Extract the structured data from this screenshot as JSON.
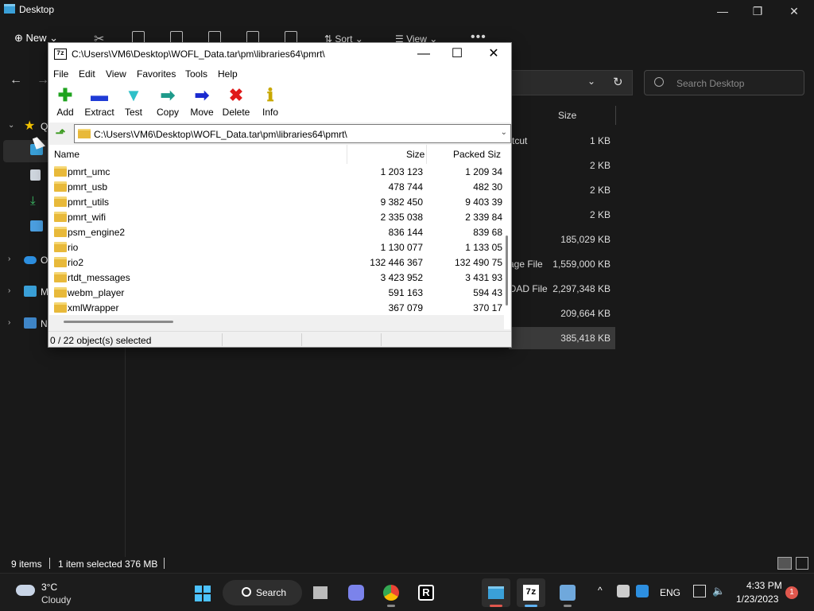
{
  "explorer": {
    "title": "Desktop",
    "toolbar": {
      "new_label": "New",
      "sort_label": "Sort",
      "view_label": "View",
      "more": "•••"
    },
    "search_placeholder": "Search Desktop",
    "sidebar": [
      {
        "label": "Q",
        "icon": "star-icon",
        "expand": "⌄"
      },
      {
        "label": "",
        "icon": "desktop-folder-icon",
        "expand": ""
      },
      {
        "label": "",
        "icon": "documents-icon",
        "expand": ""
      },
      {
        "label": "",
        "icon": "downloads-icon",
        "expand": ""
      },
      {
        "label": "",
        "icon": "pictures-icon",
        "expand": ""
      },
      {
        "label": "O",
        "icon": "onedrive-icon",
        "expand": "›"
      },
      {
        "label": "M",
        "icon": "this-pc-icon",
        "expand": "›"
      },
      {
        "label": "N",
        "icon": "network-icon",
        "expand": "›"
      }
    ],
    "size_column": "Size",
    "rows": [
      {
        "type": "rtcut",
        "size": "1 KB"
      },
      {
        "type": "",
        "size": "2 KB"
      },
      {
        "type": "",
        "size": "2 KB"
      },
      {
        "type": "",
        "size": "2 KB"
      },
      {
        "type": "",
        "size": "185,029 KB"
      },
      {
        "type": "age File",
        "size": "1,559,000 KB"
      },
      {
        "type": "OAD File",
        "size": "2,297,348 KB"
      },
      {
        "type": "",
        "size": "209,664 KB"
      },
      {
        "type": "",
        "size": "385,418 KB"
      }
    ],
    "status": {
      "items": "9 items",
      "selected": "1 item selected  376 MB"
    }
  },
  "sevenzip": {
    "icon_text": "7z",
    "title": "C:\\Users\\VM6\\Desktop\\WOFL_Data.tar\\pm\\libraries64\\pmrt\\",
    "menu": [
      "File",
      "Edit",
      "View",
      "Favorites",
      "Tools",
      "Help"
    ],
    "tools": [
      {
        "label": "Add",
        "glyph": "✚",
        "color": "#1fa31f"
      },
      {
        "label": "Extract",
        "glyph": "▬",
        "color": "#1f3bd6"
      },
      {
        "label": "Test",
        "glyph": "▼",
        "color": "#2ec0c8"
      },
      {
        "label": "Copy",
        "glyph": "➡",
        "color": "#1e9a8a"
      },
      {
        "label": "Move",
        "glyph": "➡",
        "color": "#1a2ad0"
      },
      {
        "label": "Delete",
        "glyph": "✖",
        "color": "#e01a1a"
      },
      {
        "label": "Info",
        "glyph": "ℹ",
        "color": "#c8a800"
      }
    ],
    "path": "C:\\Users\\VM6\\Desktop\\WOFL_Data.tar\\pm\\libraries64\\pmrt\\",
    "columns": {
      "name": "Name",
      "size": "Size",
      "packed": "Packed Siz"
    },
    "rows": [
      {
        "name": "pmrt_umc",
        "size": "1 203 123",
        "packed": "1 209 34"
      },
      {
        "name": "pmrt_usb",
        "size": "478 744",
        "packed": "482 30"
      },
      {
        "name": "pmrt_utils",
        "size": "9 382 450",
        "packed": "9 403 39"
      },
      {
        "name": "pmrt_wifi",
        "size": "2 335 038",
        "packed": "2 339 84"
      },
      {
        "name": "psm_engine2",
        "size": "836 144",
        "packed": "839 68"
      },
      {
        "name": "rio",
        "size": "1 130 077",
        "packed": "1 133 05"
      },
      {
        "name": "rio2",
        "size": "132 446 367",
        "packed": "132 490 75"
      },
      {
        "name": "rtdt_messages",
        "size": "3 423 952",
        "packed": "3 431 93"
      },
      {
        "name": "webm_player",
        "size": "591 163",
        "packed": "594 43"
      },
      {
        "name": "xmlWrapper",
        "size": "367 079",
        "packed": "370 17"
      }
    ],
    "status": "0 / 22 object(s) selected"
  },
  "taskbar": {
    "weather": {
      "temp": "3°C",
      "condition": "Cloudy"
    },
    "search_label": "Search",
    "language": "ENG",
    "time": "4:33 PM",
    "date": "1/23/2023",
    "notifications": "1"
  }
}
